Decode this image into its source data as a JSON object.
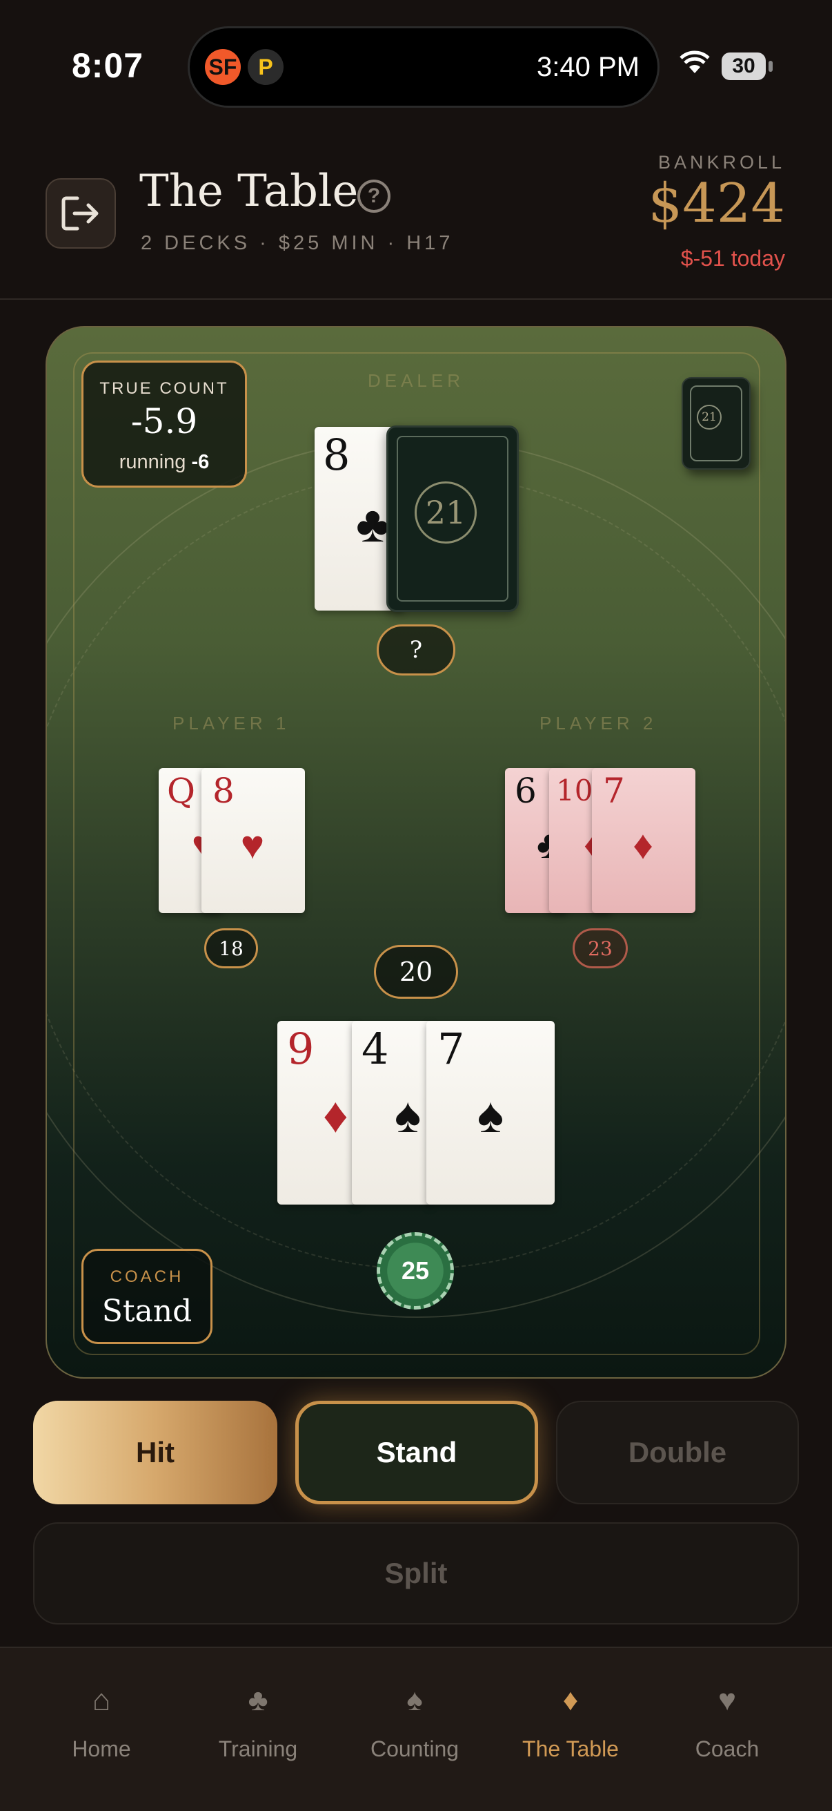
{
  "status": {
    "time": "8:07",
    "island_time": "3:40 PM",
    "battery": "30",
    "app1": "SF",
    "app2": "P"
  },
  "header": {
    "title": "The Table",
    "subtitle": "2 DECKS · $25 MIN · H17",
    "help": "?",
    "bankroll_label": "BANKROLL",
    "bankroll": "$424",
    "today": "$-51 today"
  },
  "table": {
    "true_count_label": "TRUE COUNT",
    "true_count": "-5.9",
    "running_label": "running",
    "running_value": "-6",
    "dealer_label": "DEALER",
    "shoe_logo": "21",
    "hole_logo": "21",
    "dealer_card": {
      "rank": "8",
      "suit": "♣"
    },
    "dealer_total": "?",
    "player1": {
      "label": "PLAYER 1",
      "cards": [
        {
          "rank": "Q",
          "suit": "♥"
        },
        {
          "rank": "8",
          "suit": "♥"
        }
      ],
      "total": "18"
    },
    "player2": {
      "label": "PLAYER 2",
      "cards": [
        {
          "rank": "6",
          "suit": "♣"
        },
        {
          "rank": "10",
          "suit": "♦"
        },
        {
          "rank": "7",
          "suit": "♦"
        }
      ],
      "total": "23"
    },
    "you": {
      "cards": [
        {
          "rank": "9",
          "suit": "♦"
        },
        {
          "rank": "4",
          "suit": "♠"
        },
        {
          "rank": "7",
          "suit": "♠"
        }
      ],
      "total": "20"
    },
    "chip": "25",
    "coach_label": "COACH",
    "coach_advice": "Stand"
  },
  "actions": {
    "hit": "Hit",
    "stand": "Stand",
    "double": "Double",
    "split": "Split"
  },
  "tabs": [
    {
      "label": "Home",
      "icon": "home-icon",
      "glyph": "⌂"
    },
    {
      "label": "Training",
      "icon": "club-icon",
      "glyph": "♣"
    },
    {
      "label": "Counting",
      "icon": "spade-icon",
      "glyph": "♠"
    },
    {
      "label": "The Table",
      "icon": "diamond-icon",
      "glyph": "♦"
    },
    {
      "label": "Coach",
      "icon": "heart-icon",
      "glyph": "♥"
    }
  ],
  "colors": {
    "accent": "#c8914a",
    "loss": "#e2524c",
    "felt": "#4a5d35"
  }
}
